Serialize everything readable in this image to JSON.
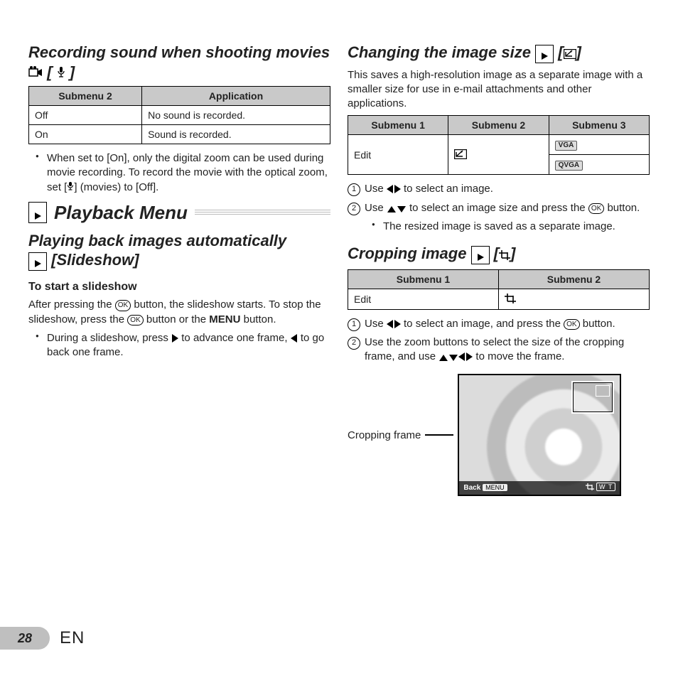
{
  "left": {
    "title1_a": "Recording sound when shooting movies ",
    "title1_b": " [",
    "title1_c": "]",
    "mic_symbol": "🎤",
    "movie_symbol": "🎥",
    "table1": {
      "h1": "Submenu 2",
      "h2": "Application",
      "r1c1": "Off",
      "r1c2": "No sound is recorded.",
      "r2c1": "On",
      "r2c2": "Sound is recorded."
    },
    "note1a": "When set to [On], only the digital zoom can be used during movie recording. To record the movie with the optical zoom, set [",
    "note1b": "] (movies) to [Off].",
    "playback_menu": "Playback Menu",
    "title2": "Playing back images automatically ",
    "title2_tail": " [Slideshow]",
    "sub_start": "To start a slideshow",
    "para_a": "After pressing the ",
    "para_b": " button, the slideshow starts. To stop the slideshow, press the ",
    "para_c": " button or the ",
    "para_d": " button.",
    "menu_word": "MENU",
    "bullet_a": "During a slideshow, press ",
    "bullet_b": " to advance one frame, ",
    "bullet_c": " to go back one frame."
  },
  "right": {
    "title1": "Changing the image size ",
    "title1_b": " [",
    "title1_c": "]",
    "intro": "This saves a high-resolution image as a separate image with a smaller size for use in e-mail attachments and other applications.",
    "table1": {
      "h1": "Submenu 1",
      "h2": "Submenu 2",
      "h3": "Submenu 3",
      "r1c1": "Edit",
      "vga": "VGA",
      "qvga": "QVGA"
    },
    "step1_a": "Use ",
    "step1_b": " to select an image.",
    "step2_a": "Use ",
    "step2_b": " to select an image size and press the ",
    "step2_c": " button.",
    "bullet1": "The resized image is saved as a separate image.",
    "title2": "Cropping image ",
    "title2_b": " [",
    "title2_c": "]",
    "table2": {
      "h1": "Submenu 1",
      "h2": "Submenu 2",
      "r1c1": "Edit"
    },
    "cstep1_a": "Use ",
    "cstep1_b": " to select an image, and press the ",
    "cstep1_c": " button.",
    "cstep2_a": "Use the zoom buttons to select the size of the cropping frame, and use ",
    "cstep2_b": " to move the frame.",
    "crop_label": "Cropping frame",
    "back": "Back",
    "menu": "MENU",
    "wt": "W T"
  },
  "footer": {
    "page": "28",
    "lang": "EN"
  },
  "ok_label": "OK"
}
